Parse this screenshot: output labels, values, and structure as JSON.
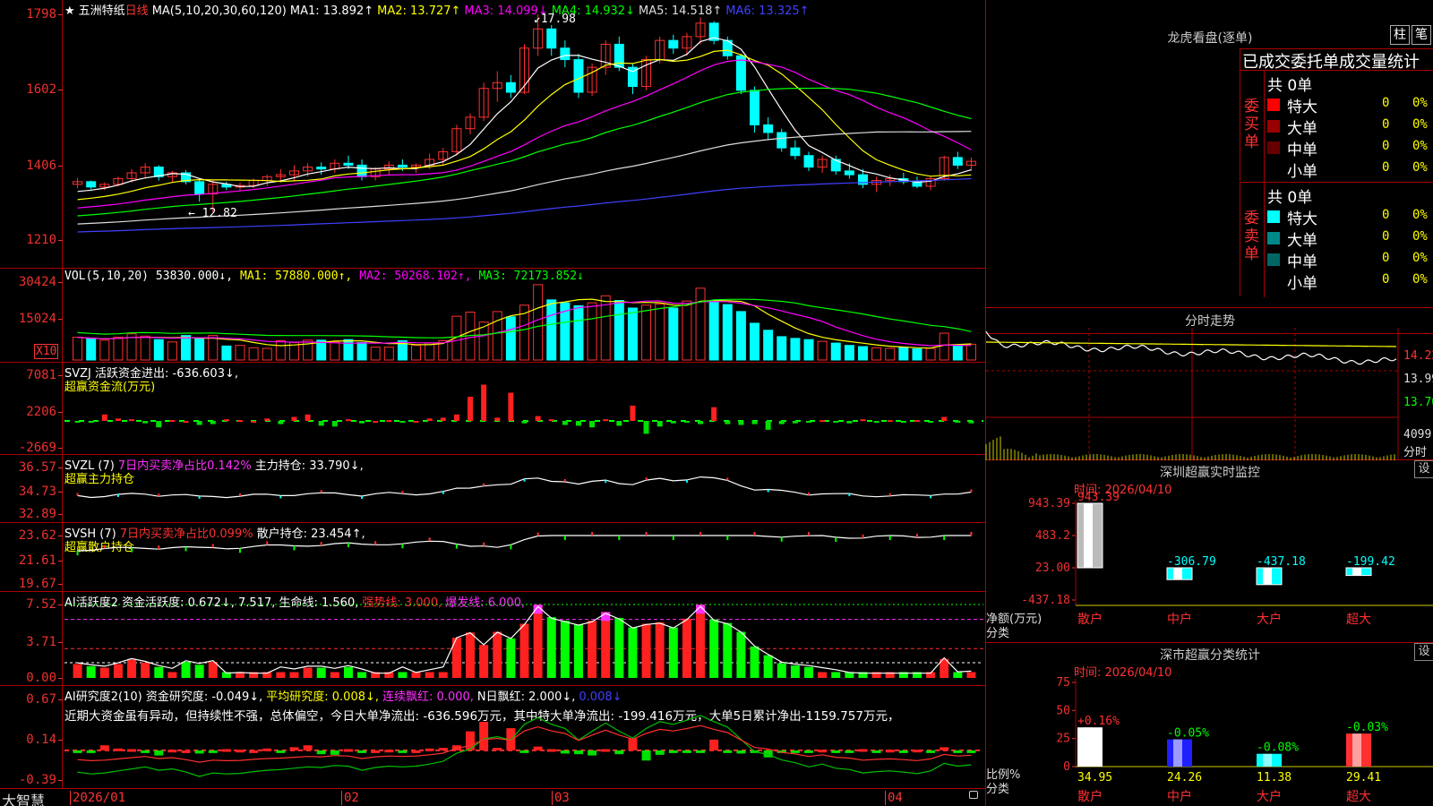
{
  "stock": {
    "star": "★",
    "name": "五洲特纸",
    "period": "日线"
  },
  "main_chart": {
    "ma_header": "MA(5,10,20,30,60,120)",
    "ma_values": [
      {
        "label": "MA1: 13.892↑",
        "color": "#ffffff"
      },
      {
        "label": "MA2: 13.727↑",
        "color": "#ffff00"
      },
      {
        "label": "MA3: 14.099↓",
        "color": "#ff00ff"
      },
      {
        "label": "MA4: 14.932↓",
        "color": "#00ff00"
      },
      {
        "label": "MA5: 14.518↑",
        "color": "#dddddd"
      },
      {
        "label": "MA6: 13.325↑",
        "color": "#4040ff"
      }
    ],
    "ticks": [
      "1798",
      "1602",
      "1406",
      "1210"
    ],
    "high_label": "17.98",
    "low_label": "12.82"
  },
  "vol_panel": {
    "header": "VOL(5,10,20)",
    "values": [
      {
        "label": "53830.000↓,",
        "color": "#ffffff"
      },
      {
        "label": "MA1: 57880.000↑,",
        "color": "#ffff00"
      },
      {
        "label": "MA2: 50268.102↑,",
        "color": "#ff00ff"
      },
      {
        "label": "MA3: 72173.852↓",
        "color": "#00ff00"
      }
    ],
    "ticks": [
      "30424",
      "15024"
    ],
    "unit": "X10"
  },
  "svzj_panel": {
    "header": "SVZJ  活跃资金进出: -636.603↓,",
    "sub": "超赢资金流(万元)",
    "ticks": [
      "7081",
      "2206",
      "-2669"
    ]
  },
  "svzl_panel": {
    "header_a": "SVZL (7)",
    "header_b": "7日内买卖净占比0.142%",
    "header_c": "主力持仓: 33.790↓,",
    "sub": "超赢主力持仓",
    "ticks": [
      "36.57",
      "34.73",
      "32.89"
    ]
  },
  "svsh_panel": {
    "header_a": "SVSH (7)",
    "header_b": "7日内买卖净占比0.099%",
    "header_c": "散户持仓: 23.454↑,",
    "sub": "超赢散户持仓",
    "ticks": [
      "23.62",
      "21.61",
      "19.67"
    ]
  },
  "ai_active_panel": {
    "header_a": "AI活跃度2 资金活跃度: 0.672↓, 7.517, 生命线: 1.560,",
    "header_b": "强势线: 3.000,",
    "header_c": "爆发线: 6.000,",
    "ticks": [
      "7.52",
      "3.71",
      "0.00"
    ]
  },
  "ai_research_panel": {
    "header_a": "AI研究度2(10) 资金研究度: -0.049↓,",
    "header_b": "平均研究度: 0.008↓,",
    "header_c": "连续飘红: 0.000,",
    "header_d": "N日飘红: 2.000↓,",
    "header_e": "0.008↓",
    "commentary": "近期大资金虽有异动，但持续性不强，总体偏空，今日大单净流出: -636.596万元，其中特大单净流出: -199.416万元，大单5日累计净出-1159.757万元，",
    "ticks": [
      "0.67",
      "0.14",
      "-0.39"
    ]
  },
  "x_axis": {
    "brand": "大智慧",
    "labels": [
      "2026/01",
      "02",
      "03",
      "04"
    ]
  },
  "dragon_tiger": {
    "title": "龙虎看盘(逐单)",
    "btn_a": "柱",
    "btn_b": "笔",
    "tabs": "已成交委托单成交量统计",
    "buy": {
      "side": "委买单",
      "total": "共 0单",
      "rows": [
        {
          "name": "特大",
          "qty": "0",
          "pct": "0%",
          "color": "#ff0000"
        },
        {
          "name": "大单",
          "qty": "0",
          "pct": "0%",
          "color": "#990000"
        },
        {
          "name": "中单",
          "qty": "0",
          "pct": "0%",
          "color": "#660000"
        },
        {
          "name": "小单",
          "qty": "0",
          "pct": "0%",
          "color": ""
        }
      ]
    },
    "sell": {
      "side": "委卖单",
      "total": "共 0单",
      "rows": [
        {
          "name": "特大",
          "qty": "0",
          "pct": "0%",
          "color": "#00ffff"
        },
        {
          "name": "大单",
          "qty": "0",
          "pct": "0%",
          "color": "#008888"
        },
        {
          "name": "中单",
          "qty": "0",
          "pct": "0%",
          "color": "#006666"
        },
        {
          "name": "小单",
          "qty": "0",
          "pct": "0%",
          "color": ""
        }
      ]
    }
  },
  "intraday": {
    "title": "分时走势",
    "ticks": [
      "14.22",
      "13.99",
      "13.76"
    ],
    "vol_tick": "4099",
    "vol_label": "分时"
  },
  "sz_monitor": {
    "title": "深圳超赢实时监控",
    "set": "设",
    "time": "时间: 2026/04/10",
    "ticks": [
      "943.39",
      "483.2",
      "23.00",
      "-437.18"
    ],
    "ylabel": "净额(万元)",
    "xlabel": "分类",
    "bars": [
      {
        "cat": "散户",
        "value": 943.39,
        "label": "943.39"
      },
      {
        "cat": "中户",
        "value": -306.79,
        "label": "-306.79"
      },
      {
        "cat": "大户",
        "value": -437.18,
        "label": "-437.18"
      },
      {
        "cat": "超大",
        "value": -199.42,
        "label": "-199.42"
      }
    ]
  },
  "sz_classify": {
    "title": "深市超赢分类统计",
    "set": "设",
    "time": "时间: 2026/04/10",
    "ticks": [
      "75",
      "50",
      "25",
      "0"
    ],
    "ylabel": "比例%",
    "xlabel": "分类",
    "bars": [
      {
        "cat": "散户",
        "value": 34.95,
        "label": "34.95",
        "chg": "+0.16%",
        "color": "#ffffff",
        "chg_color": "#ff3030"
      },
      {
        "cat": "中户",
        "value": 24.26,
        "label": "24.26",
        "chg": "-0.05%",
        "color": "#2020ff",
        "chg_color": "#00ff00"
      },
      {
        "cat": "大户",
        "value": 11.38,
        "label": "11.38",
        "chg": "-0.08%",
        "color": "#00ffff",
        "chg_color": "#00ff00"
      },
      {
        "cat": "超大",
        "value": 29.41,
        "label": "29.41",
        "chg": "-0.03%",
        "color": "#ff3030",
        "chg_color": "#00ff00"
      }
    ]
  },
  "chart_data": {
    "type": "candlestick",
    "ohlc": [
      [
        13.55,
        13.72,
        13.45,
        13.62
      ],
      [
        13.62,
        13.65,
        13.42,
        13.48
      ],
      [
        13.48,
        13.6,
        13.4,
        13.55
      ],
      [
        13.55,
        13.75,
        13.5,
        13.7
      ],
      [
        13.7,
        13.95,
        13.6,
        13.85
      ],
      [
        13.85,
        14.1,
        13.7,
        14.0
      ],
      [
        14.0,
        14.05,
        13.65,
        13.75
      ],
      [
        13.75,
        13.9,
        13.6,
        13.85
      ],
      [
        13.85,
        13.92,
        13.55,
        13.62
      ],
      [
        13.62,
        13.7,
        13.1,
        13.3
      ],
      [
        13.3,
        13.65,
        12.82,
        13.55
      ],
      [
        13.55,
        13.62,
        13.4,
        13.48
      ],
      [
        13.48,
        13.6,
        13.38,
        13.52
      ],
      [
        13.52,
        13.7,
        13.45,
        13.65
      ],
      [
        13.65,
        13.8,
        13.5,
        13.75
      ],
      [
        13.75,
        13.95,
        13.6,
        13.8
      ],
      [
        13.8,
        14.05,
        13.65,
        13.9
      ],
      [
        13.9,
        14.1,
        13.75,
        14.0
      ],
      [
        14.0,
        14.12,
        13.8,
        13.95
      ],
      [
        13.95,
        14.2,
        13.85,
        14.1
      ],
      [
        14.1,
        14.3,
        13.95,
        14.05
      ],
      [
        14.05,
        14.2,
        13.65,
        13.75
      ],
      [
        13.75,
        14.0,
        13.65,
        13.95
      ],
      [
        13.95,
        14.15,
        13.8,
        14.05
      ],
      [
        14.05,
        14.2,
        13.9,
        14.0
      ],
      [
        14.0,
        14.1,
        13.85,
        14.05
      ],
      [
        14.05,
        14.35,
        13.95,
        14.2
      ],
      [
        14.2,
        14.5,
        14.05,
        14.4
      ],
      [
        14.4,
        15.1,
        14.3,
        15.0
      ],
      [
        15.0,
        15.4,
        14.85,
        15.3
      ],
      [
        15.3,
        16.2,
        15.2,
        16.05
      ],
      [
        16.05,
        16.5,
        15.7,
        16.2
      ],
      [
        16.2,
        16.4,
        15.8,
        15.95
      ],
      [
        15.95,
        17.2,
        15.9,
        17.1
      ],
      [
        17.1,
        17.98,
        16.9,
        17.6
      ],
      [
        17.6,
        17.7,
        16.9,
        17.1
      ],
      [
        17.1,
        17.3,
        16.6,
        16.8
      ],
      [
        16.8,
        16.95,
        15.8,
        15.95
      ],
      [
        15.95,
        16.7,
        15.85,
        16.6
      ],
      [
        16.6,
        17.3,
        16.4,
        17.2
      ],
      [
        17.2,
        17.4,
        16.5,
        16.6
      ],
      [
        16.6,
        16.7,
        15.9,
        16.1
      ],
      [
        16.1,
        16.9,
        16.0,
        16.8
      ],
      [
        16.8,
        17.4,
        16.7,
        17.3
      ],
      [
        17.3,
        17.45,
        16.95,
        17.1
      ],
      [
        17.1,
        17.5,
        16.9,
        17.4
      ],
      [
        17.4,
        17.9,
        17.2,
        17.75
      ],
      [
        17.75,
        17.8,
        17.2,
        17.3
      ],
      [
        17.3,
        17.4,
        16.8,
        16.9
      ],
      [
        16.9,
        16.95,
        15.9,
        16.0
      ],
      [
        16.0,
        16.1,
        14.9,
        15.1
      ],
      [
        15.1,
        15.3,
        14.7,
        14.9
      ],
      [
        14.9,
        15.0,
        14.4,
        14.5
      ],
      [
        14.5,
        14.7,
        14.2,
        14.3
      ],
      [
        14.3,
        14.4,
        13.9,
        14.0
      ],
      [
        14.0,
        14.3,
        13.85,
        14.2
      ],
      [
        14.2,
        14.3,
        13.8,
        13.9
      ],
      [
        13.9,
        14.1,
        13.7,
        13.8
      ],
      [
        13.8,
        13.95,
        13.45,
        13.55
      ],
      [
        13.55,
        13.75,
        13.35,
        13.65
      ],
      [
        13.65,
        13.8,
        13.5,
        13.7
      ],
      [
        13.7,
        13.85,
        13.55,
        13.62
      ],
      [
        13.62,
        13.75,
        13.45,
        13.5
      ],
      [
        13.5,
        13.75,
        13.4,
        13.7
      ],
      [
        13.7,
        14.3,
        13.65,
        14.25
      ],
      [
        14.25,
        14.4,
        13.95,
        14.05
      ],
      [
        14.05,
        14.25,
        13.9,
        14.15
      ]
    ],
    "volume": [
      3.9,
      3.6,
      3.4,
      3.9,
      4.5,
      4.1,
      3.5,
      3.1,
      4.2,
      3.8,
      4.2,
      2.4,
      2.5,
      2.1,
      2.0,
      3.3,
      3.0,
      3.4,
      3.4,
      3.1,
      3.5,
      3.0,
      2.2,
      2.2,
      3.3,
      2.5,
      2.9,
      3.3,
      7.5,
      8.2,
      6.5,
      8.3,
      7.4,
      9.4,
      12.9,
      10.3,
      9.8,
      9.3,
      9.8,
      11.0,
      10.2,
      8.9,
      9.4,
      9.6,
      8.9,
      10.1,
      12.3,
      10.0,
      9.5,
      8.3,
      6.3,
      5.1,
      4.0,
      3.7,
      3.5,
      3.2,
      2.9,
      2.5,
      2.3,
      2.1,
      2.0,
      2.2,
      1.9,
      2.0,
      4.6,
      2.6,
      2.7
    ],
    "svzj": [
      -0.2,
      -0.1,
      0.8,
      0.3,
      0.2,
      -0.3,
      -0.8,
      0.1,
      0.0,
      -0.5,
      -0.4,
      0.2,
      0.1,
      0.0,
      0.3,
      -0.4,
      0.5,
      0.8,
      -0.6,
      -0.7,
      0.2,
      -0.3,
      0.0,
      0.1,
      -0.2,
      0.0,
      0.3,
      0.4,
      0.8,
      3.0,
      4.5,
      0.4,
      3.5,
      -0.3,
      0.6,
      0.2,
      -0.5,
      -0.6,
      -0.8,
      0.2,
      -0.6,
      1.9,
      -1.6,
      -0.7,
      -0.3,
      -0.2,
      -0.4,
      1.7,
      -0.4,
      -0.5,
      -0.4,
      -1.1,
      -0.4,
      -0.3,
      -0.2,
      0.1,
      -0.2,
      -0.3,
      0.2,
      -0.1,
      0.1,
      -0.1,
      0.1,
      -0.2,
      0.5,
      -0.2,
      -0.3
    ],
    "ma_note": "overlay lines drawn from computed moving averages"
  }
}
